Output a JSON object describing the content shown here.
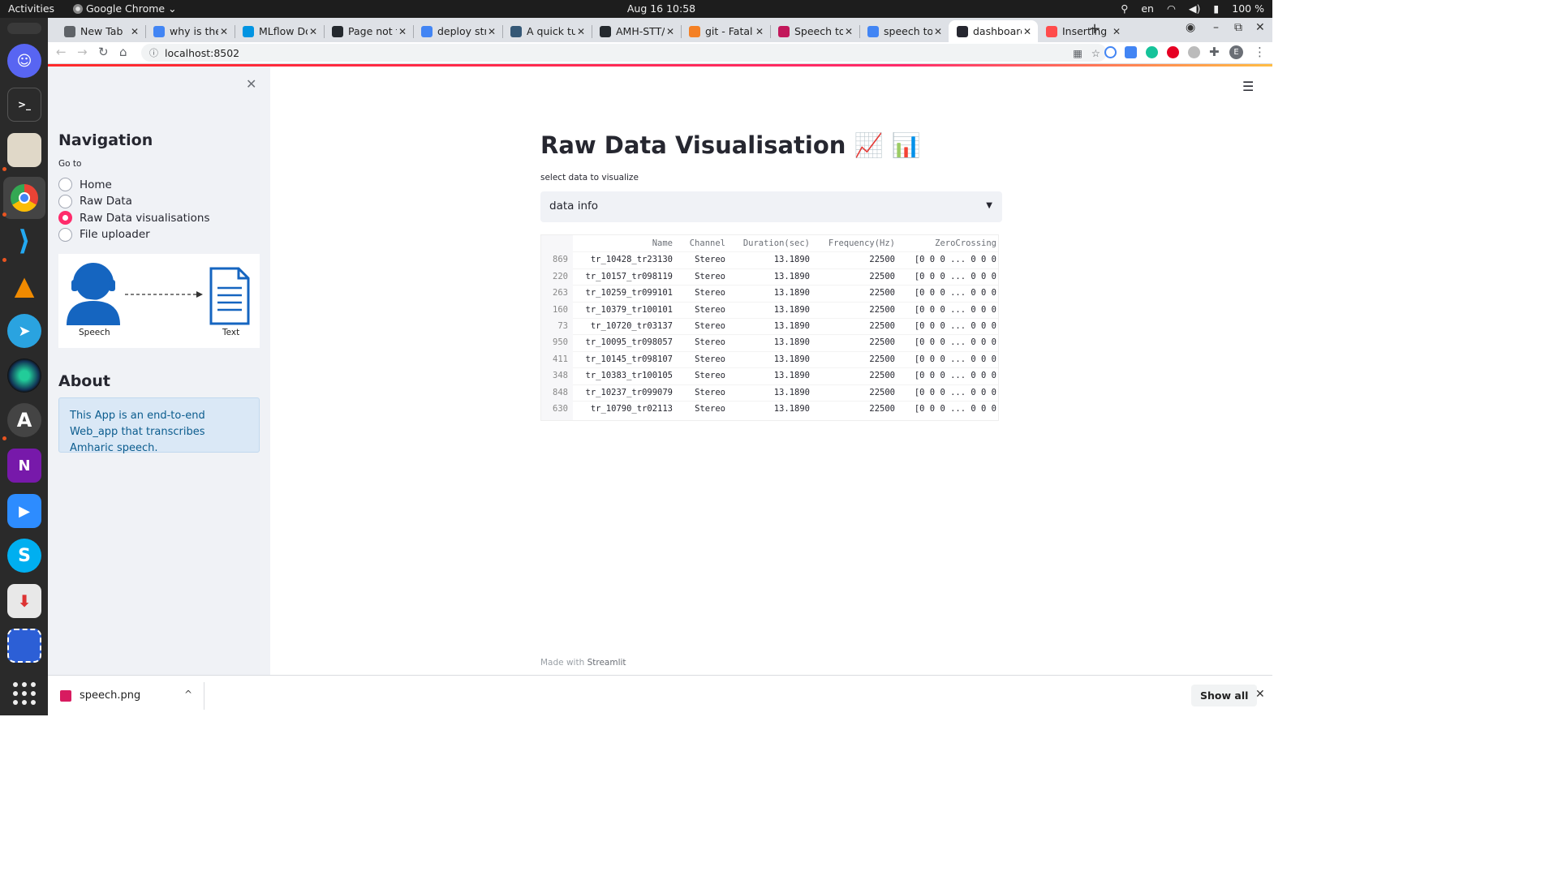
{
  "os": {
    "activities": "Activities",
    "app_name": "Google Chrome",
    "clock": "Aug 16  10:58",
    "lang": "en",
    "battery": "100 %"
  },
  "browser": {
    "tabs": [
      {
        "title": "New Tab",
        "icon": "chrome-icon",
        "color": "#5f6368"
      },
      {
        "title": "why is the",
        "icon": "google-icon",
        "color": "#4285f4"
      },
      {
        "title": "MLflow Do",
        "icon": "mlflow-icon",
        "color": "#0194e2"
      },
      {
        "title": "Page not f",
        "icon": "github-icon",
        "color": "#24292e"
      },
      {
        "title": "deploy str",
        "icon": "google-icon",
        "color": "#4285f4"
      },
      {
        "title": "A quick tu",
        "icon": "tds-icon",
        "color": "#355876"
      },
      {
        "title": "AMH-STT/",
        "icon": "github-icon",
        "color": "#24292e"
      },
      {
        "title": "git - Fatal:",
        "icon": "stackoverflow-icon",
        "color": "#f48024"
      },
      {
        "title": "Speech to",
        "icon": "speech-icon",
        "color": "#c2185b"
      },
      {
        "title": "speech to",
        "icon": "google-icon",
        "color": "#4285f4"
      },
      {
        "title": "dashboard",
        "icon": "streamlit-icon",
        "color": "#262730"
      },
      {
        "title": "Inserting I",
        "icon": "streamlit-icon",
        "color": "#ff4b4b"
      }
    ],
    "active_tab": 10,
    "url": "localhost:8502",
    "profile_initial": "E"
  },
  "sidebar": {
    "nav_title": "Navigation",
    "goto_label": "Go to",
    "options": [
      "Home",
      "Raw Data",
      "Raw Data visualisations",
      "File uploader"
    ],
    "selected": 2,
    "image_labels": {
      "left": "Speech",
      "right": "Text"
    },
    "about_title": "About",
    "about_text": "This App is an end-to-end Web_app that transcribes Amharic speech."
  },
  "main": {
    "title": "Raw Data Visualisation 📈 📊",
    "select_label": "select data to visualize",
    "select_value": "data info",
    "table": {
      "columns": [
        "Name",
        "Channel",
        "Duration(sec)",
        "Frequency(Hz)",
        "ZeroCrossing"
      ],
      "rows": [
        {
          "index": "869",
          "cells": [
            "tr_10428_tr23130",
            "Stereo",
            "13.1890",
            "22500",
            "[0 0 0 ... 0 0 0"
          ]
        },
        {
          "index": "220",
          "cells": [
            "tr_10157_tr098119",
            "Stereo",
            "13.1890",
            "22500",
            "[0 0 0 ... 0 0 0"
          ]
        },
        {
          "index": "263",
          "cells": [
            "tr_10259_tr099101",
            "Stereo",
            "13.1890",
            "22500",
            "[0 0 0 ... 0 0 0"
          ]
        },
        {
          "index": "160",
          "cells": [
            "tr_10379_tr100101",
            "Stereo",
            "13.1890",
            "22500",
            "[0 0 0 ... 0 0 0"
          ]
        },
        {
          "index": "73",
          "cells": [
            "tr_10720_tr03137",
            "Stereo",
            "13.1890",
            "22500",
            "[0 0 0 ... 0 0 0"
          ]
        },
        {
          "index": "950",
          "cells": [
            "tr_10095_tr098057",
            "Stereo",
            "13.1890",
            "22500",
            "[0 0 0 ... 0 0 0"
          ]
        },
        {
          "index": "411",
          "cells": [
            "tr_10145_tr098107",
            "Stereo",
            "13.1890",
            "22500",
            "[0 0 0 ... 0 0 0"
          ]
        },
        {
          "index": "348",
          "cells": [
            "tr_10383_tr100105",
            "Stereo",
            "13.1890",
            "22500",
            "[0 0 0 ... 0 0 0"
          ]
        },
        {
          "index": "848",
          "cells": [
            "tr_10237_tr099079",
            "Stereo",
            "13.1890",
            "22500",
            "[0 0 0 ... 0 0 0"
          ]
        },
        {
          "index": "630",
          "cells": [
            "tr_10790_tr02113",
            "Stereo",
            "13.1890",
            "22500",
            "[0 0 0 ... 0 0 0"
          ]
        }
      ]
    },
    "footer_prefix": "Made with",
    "footer_brand": "Streamlit"
  },
  "downloads": {
    "file_name": "speech.png",
    "show_all": "Show all"
  },
  "colors": {
    "accent": "#ff2b6b",
    "sidebar_bg": "#f0f2f6",
    "info_bg": "#dae8f6",
    "info_text": "#0b5c8e"
  }
}
